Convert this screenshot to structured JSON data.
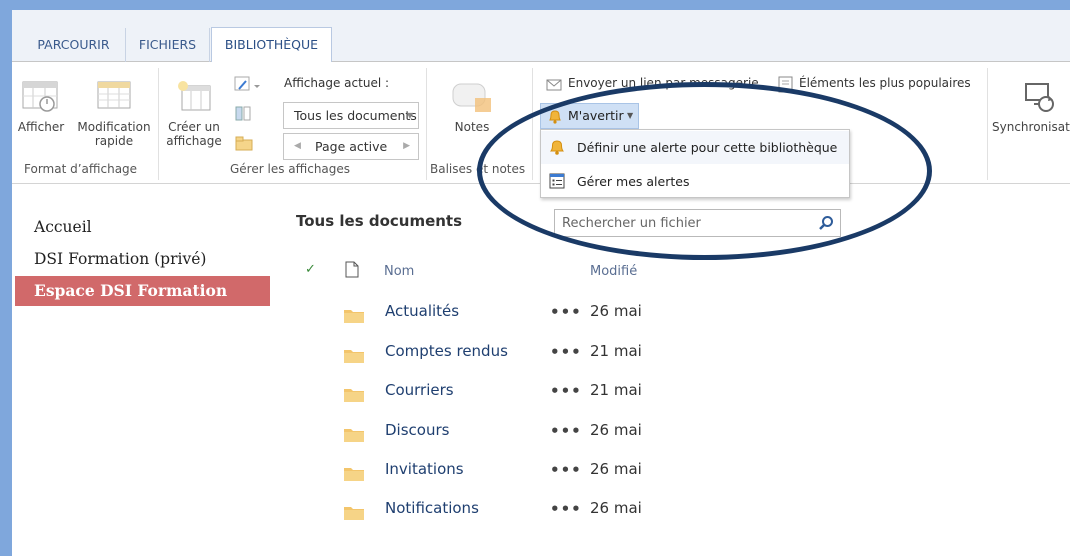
{
  "tabs": [
    {
      "label": "PARCOURIR"
    },
    {
      "label": "FICHIERS"
    },
    {
      "label": "BIBLIOTHÈQUE"
    }
  ],
  "ribbon": {
    "format_group": {
      "afficher": "Afficher",
      "modification_line1": "Modification",
      "modification_line2": "rapide",
      "label": "Format d’affichage"
    },
    "views_group": {
      "creer_line1": "Créer un",
      "creer_line2": "affichage",
      "current_view_label": "Affichage actuel :",
      "current_view_value": "Tous les documents",
      "page_label": "Page active",
      "label": "Gérer les affichages"
    },
    "tags_group": {
      "notes": "Notes",
      "label": "Balises et notes"
    },
    "share_group": {
      "email_link": "Envoyer un lien par messagerie",
      "popular": "Éléments les plus populaires",
      "alert_button": "M'avertir"
    },
    "sync_group": {
      "sync": "Synchronisation"
    }
  },
  "alert_menu": {
    "items": [
      {
        "label": "Définir une alerte pour cette bibliothèque"
      },
      {
        "label": "Gérer mes alertes"
      }
    ]
  },
  "nav": {
    "items": [
      {
        "label": "Accueil"
      },
      {
        "label": "DSI Formation (privé)"
      },
      {
        "label": "Espace DSI Formation"
      }
    ]
  },
  "library": {
    "view_title": "Tous les documents",
    "search_placeholder": "Rechercher un fichier",
    "columns": {
      "name": "Nom",
      "modified": "Modifié"
    },
    "rows": [
      {
        "name": "Actualités",
        "modified": "26 mai"
      },
      {
        "name": "Comptes rendus",
        "modified": "21 mai"
      },
      {
        "name": "Courriers",
        "modified": "21 mai"
      },
      {
        "name": "Discours",
        "modified": "26 mai"
      },
      {
        "name": "Invitations",
        "modified": "26 mai"
      },
      {
        "name": "Notifications",
        "modified": "26 mai"
      }
    ],
    "ellipsis": "•••"
  },
  "colors": {
    "accent_blue": "#7fa7dc",
    "nav_active": "#d1696a",
    "annotation": "#1a3a66"
  }
}
